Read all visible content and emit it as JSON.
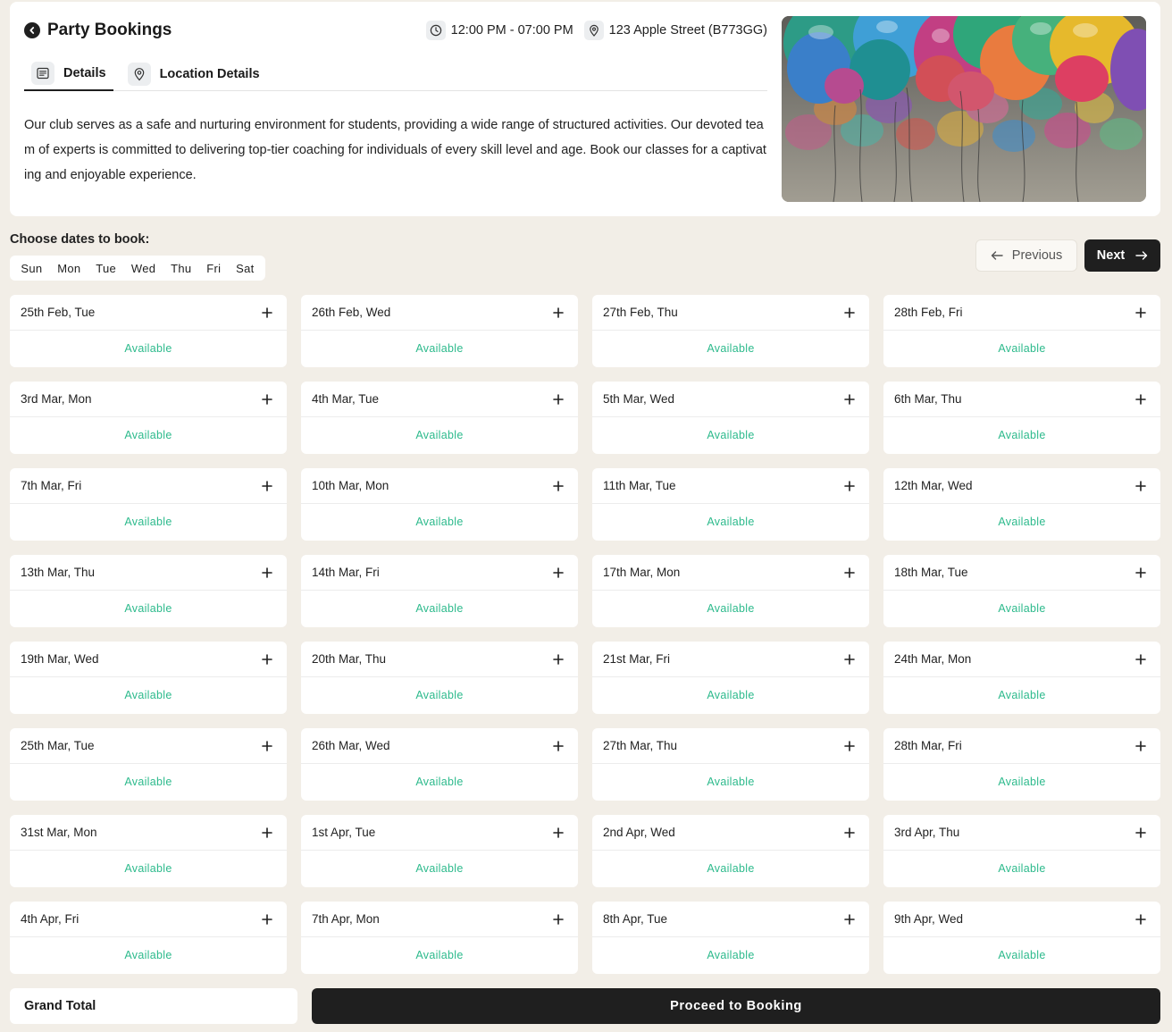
{
  "header": {
    "title": "Party Bookings",
    "time": "12:00 PM - 07:00 PM",
    "address": "123 Apple Street (B773GG)"
  },
  "tabs": [
    {
      "label": "Details",
      "icon": "document-icon",
      "active": true
    },
    {
      "label": "Location Details",
      "icon": "map-pin-icon",
      "active": false
    }
  ],
  "description": "Our club serves as a safe and nurturing environment for students, providing a wide range of structured activities. Our devoted team of experts is committed to delivering top-tier coaching for individuals of every skill level and age. Book our classes for a captivating and enjoyable experience.",
  "hero_image": "balloons-photo",
  "schedule": {
    "choose_label": "Choose dates to book:",
    "days": [
      "Sun",
      "Mon",
      "Tue",
      "Wed",
      "Thu",
      "Fri",
      "Sat"
    ],
    "previous_label": "Previous",
    "next_label": "Next",
    "dates": [
      {
        "label": "25th Feb, Tue",
        "status": "Available"
      },
      {
        "label": "26th Feb, Wed",
        "status": "Available"
      },
      {
        "label": "27th Feb, Thu",
        "status": "Available"
      },
      {
        "label": "28th Feb, Fri",
        "status": "Available"
      },
      {
        "label": "3rd Mar, Mon",
        "status": "Available"
      },
      {
        "label": "4th Mar, Tue",
        "status": "Available"
      },
      {
        "label": "5th Mar, Wed",
        "status": "Available"
      },
      {
        "label": "6th Mar, Thu",
        "status": "Available"
      },
      {
        "label": "7th Mar, Fri",
        "status": "Available"
      },
      {
        "label": "10th Mar, Mon",
        "status": "Available"
      },
      {
        "label": "11th Mar, Tue",
        "status": "Available"
      },
      {
        "label": "12th Mar, Wed",
        "status": "Available"
      },
      {
        "label": "13th Mar, Thu",
        "status": "Available"
      },
      {
        "label": "14th Mar, Fri",
        "status": "Available"
      },
      {
        "label": "17th Mar, Mon",
        "status": "Available"
      },
      {
        "label": "18th Mar, Tue",
        "status": "Available"
      },
      {
        "label": "19th Mar, Wed",
        "status": "Available"
      },
      {
        "label": "20th Mar, Thu",
        "status": "Available"
      },
      {
        "label": "21st Mar, Fri",
        "status": "Available"
      },
      {
        "label": "24th Mar, Mon",
        "status": "Available"
      },
      {
        "label": "25th Mar, Tue",
        "status": "Available"
      },
      {
        "label": "26th Mar, Wed",
        "status": "Available"
      },
      {
        "label": "27th Mar, Thu",
        "status": "Available"
      },
      {
        "label": "28th Mar, Fri",
        "status": "Available"
      },
      {
        "label": "31st Mar, Mon",
        "status": "Available"
      },
      {
        "label": "1st Apr, Tue",
        "status": "Available"
      },
      {
        "label": "2nd Apr, Wed",
        "status": "Available"
      },
      {
        "label": "3rd Apr, Thu",
        "status": "Available"
      },
      {
        "label": "4th Apr, Fri",
        "status": "Available"
      },
      {
        "label": "7th Apr, Mon",
        "status": "Available"
      },
      {
        "label": "8th Apr, Tue",
        "status": "Available"
      },
      {
        "label": "9th Apr, Wed",
        "status": "Available"
      }
    ]
  },
  "footer": {
    "grand_total_label": "Grand Total",
    "proceed_label": "Proceed to Booking"
  },
  "colors": {
    "background": "#f2eee7",
    "accent_dark": "#1f1f1f",
    "available": "#2dba8c"
  }
}
